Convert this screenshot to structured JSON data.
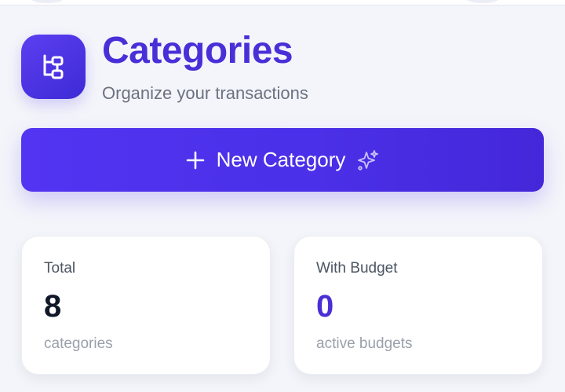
{
  "header": {
    "title": "Categories",
    "subtitle": "Organize your transactions",
    "logo_icon": "category-tree-icon"
  },
  "actions": {
    "new_category_label": "New Category",
    "plus_icon": "plus-icon",
    "sparkle_icon": "sparkle-icon"
  },
  "stats": [
    {
      "label": "Total",
      "value": "8",
      "sub": "categories",
      "value_color": "#111827"
    },
    {
      "label": "With Budget",
      "value": "0",
      "sub": "active budgets",
      "value_color": "#4a2fd8"
    }
  ],
  "colors": {
    "accent": "#4a2fd8",
    "background": "#f4f5fa",
    "button": "#4e33ee"
  }
}
